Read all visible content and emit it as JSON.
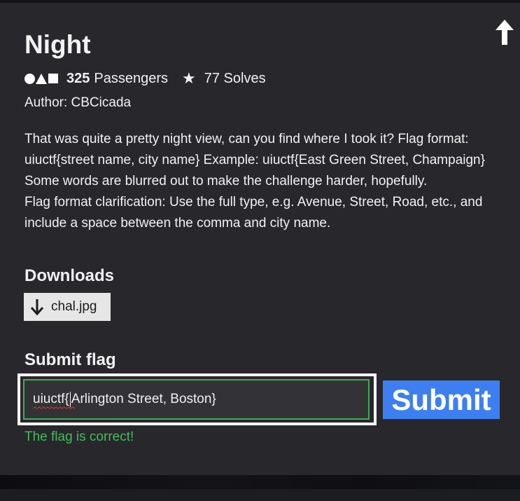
{
  "challenge": {
    "title": "Night",
    "passengers_count": "325",
    "passengers_label": "Passengers",
    "solves_label": "77 Solves",
    "author": "Author: CBCicada",
    "description": [
      "That was quite a pretty night view, can you find where I took it? Flag format: uiuctf{street name, city name} Example: uiuctf{East Green Street, Champaign}",
      "Some words are blurred out to make the challenge harder, hopefully.",
      "Flag format clarification: Use the full type, e.g. Avenue, Street, Road, etc., and include a space between the comma and city name."
    ]
  },
  "downloads": {
    "heading": "Downloads",
    "files": [
      "chal.jpg"
    ]
  },
  "submit": {
    "heading": "Submit flag",
    "value_prefix": "uiuctf{",
    "value_rest": "Arlington Street, Boston}",
    "button_label": "Submit",
    "status_text": "The flag is correct!"
  },
  "colors": {
    "card_background": "#28272c",
    "accent_blue": "#3d7ff1",
    "success_green": "#3fbf5a",
    "input_border_green": "#3fae54"
  },
  "icons": [
    "up-arrow-icon",
    "shapes-icon",
    "star-icon",
    "download-arrow-icon"
  ]
}
